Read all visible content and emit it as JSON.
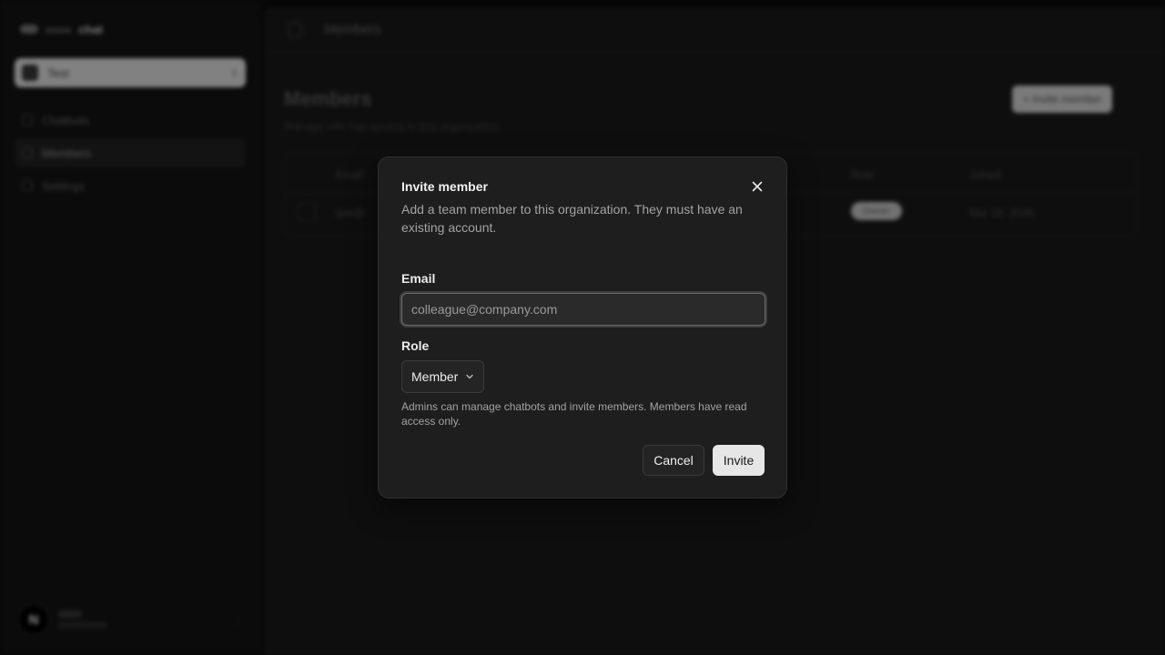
{
  "background": {
    "brand": {
      "prefix": "www",
      "name": "chat"
    },
    "org_switcher": {
      "label": "Test"
    },
    "nav": [
      {
        "label": "Chatbots",
        "icon": "bot-icon"
      },
      {
        "label": "Members",
        "icon": "users-icon"
      },
      {
        "label": "Settings",
        "icon": "gear-icon"
      }
    ],
    "user": {
      "avatar_letter": "N"
    },
    "breadcrumb": "Members",
    "page_title": "Members",
    "page_subtitle": "Manage who has access to this organization",
    "invite_button_label": "+ Invite member",
    "table": {
      "headers": [
        "Email",
        "Role",
        "Joined"
      ],
      "rows": [
        {
          "email": "test@",
          "role": "Owner",
          "joined": "Mar 18, 2026"
        }
      ]
    }
  },
  "dialog": {
    "title": "Invite member",
    "description": "Add a team member to this organization. They must have an existing account.",
    "email": {
      "label": "Email",
      "placeholder": "colleague@company.com",
      "value": ""
    },
    "role": {
      "label": "Role",
      "selected": "Member"
    },
    "helper": "Admins can manage chatbots and invite members. Members have read access only.",
    "cancel_label": "Cancel",
    "invite_label": "Invite"
  }
}
